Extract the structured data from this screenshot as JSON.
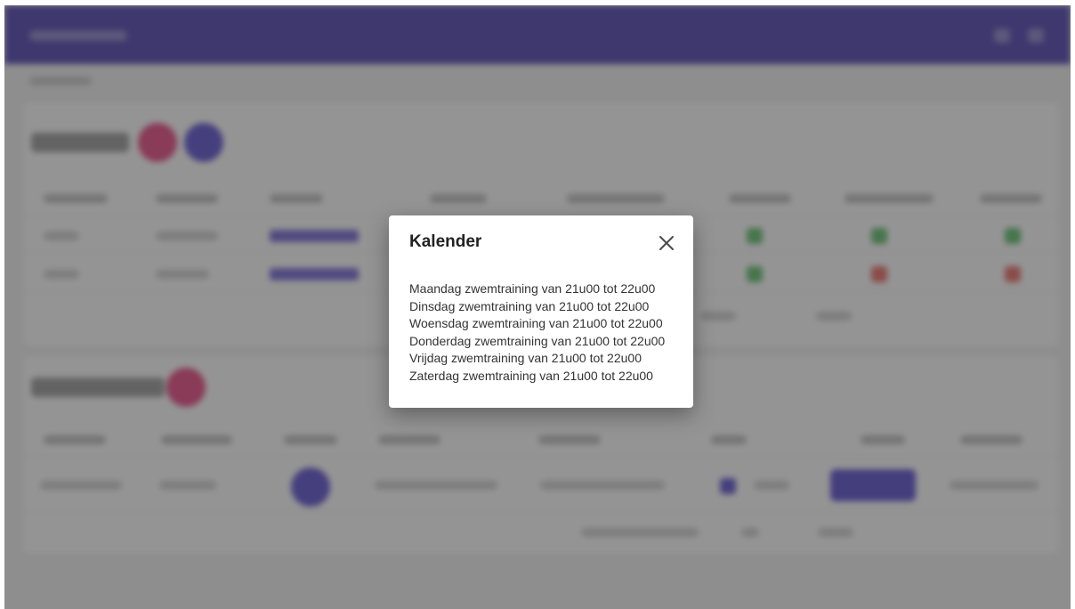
{
  "dialog": {
    "title": "Kalender",
    "close_icon": "close-icon",
    "lines": [
      "Maandag zwemtraining van 21u00 tot 22u00",
      "Dinsdag zwemtraining van 21u00 tot 22u00",
      "Woensdag zwemtraining van 21u00 tot 22u00",
      "Donderdag zwemtraining van 21u00 tot 22u00",
      "Vrijdag zwemtraining van 21u00 tot 22u00",
      "Zaterdag zwemtraining van 21u00 tot 22u00"
    ]
  },
  "colors": {
    "app_bar": "#4d3fb0",
    "accent_pink": "#e9457f",
    "accent_purple": "#5b4fd0",
    "status_green": "#5fbf6a",
    "status_red": "#ea6a62",
    "scrim": "rgba(50,50,50,0.52)"
  }
}
